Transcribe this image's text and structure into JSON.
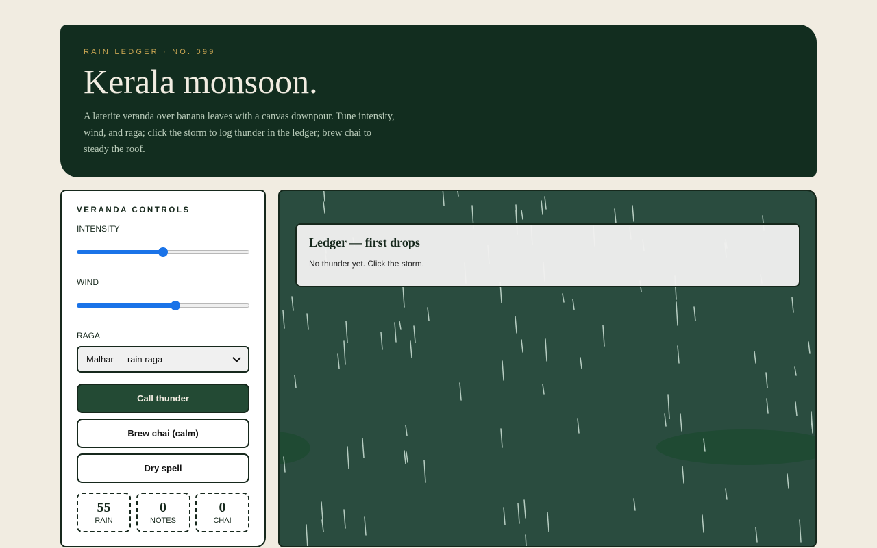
{
  "hero": {
    "kicker": "RAIN LEDGER · NO. 099",
    "title": "Kerala monsoon.",
    "lede": "A laterite veranda over banana leaves with a canvas downpour. Tune intensity, wind, and raga; click the storm to log thunder in the ledger; brew chai to steady the roof."
  },
  "controls": {
    "title": "VERANDA CONTROLS",
    "intensity": {
      "label": "INTENSITY",
      "value": 0.5
    },
    "wind": {
      "label": "WIND",
      "value": 0.57
    },
    "raga": {
      "label": "RAGA",
      "selected": "Malhar — rain raga"
    },
    "buttons": {
      "thunder": "Call thunder",
      "chai": "Brew chai (calm)",
      "dry": "Dry spell"
    },
    "stats": [
      {
        "value": "55",
        "label": "RAIN"
      },
      {
        "value": "0",
        "label": "NOTES"
      },
      {
        "value": "0",
        "label": "CHAI"
      }
    ]
  },
  "ledger": {
    "title": "Ledger — first drops",
    "entry": "No thunder yet. Click the storm."
  },
  "colors": {
    "hero_bg": "#122d1f",
    "storm_bg": "#2a4c3f",
    "accent_gold": "#c9a552",
    "primary_button": "#234a34",
    "slider_blue": "#1a73e8"
  }
}
